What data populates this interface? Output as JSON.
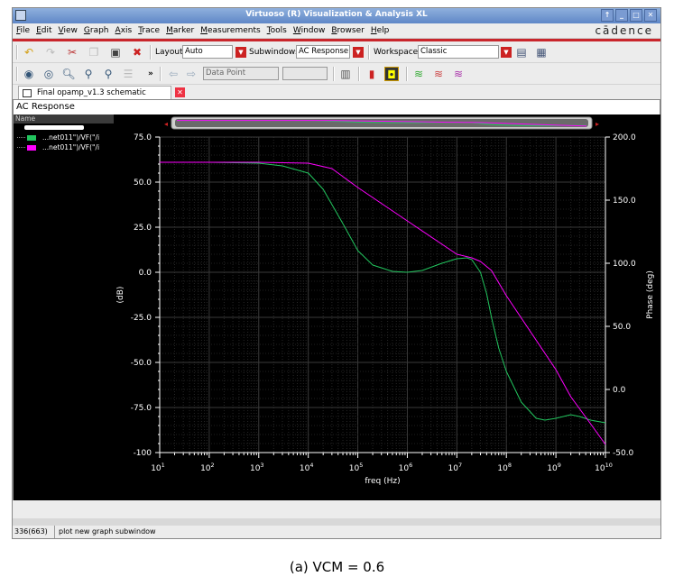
{
  "window": {
    "title": "Virtuoso (R) Visualization & Analysis XL"
  },
  "menubar": {
    "items": [
      "File",
      "Edit",
      "View",
      "Graph",
      "Axis",
      "Trace",
      "Marker",
      "Measurements",
      "Tools",
      "Window",
      "Browser",
      "Help"
    ],
    "brand": "cādence"
  },
  "toolbar1": {
    "layout_label": "Layout:",
    "layout_value": "Auto",
    "subwindows_label": "Subwindows:",
    "subwindows_value": "AC Response",
    "workspace_label": "Workspace:",
    "workspace_value": "Classic"
  },
  "toolbar2": {
    "marker_mode": "Data Point",
    "more": "»"
  },
  "tab": {
    "label": "Final opamp_v1.3 schematic"
  },
  "panel": {
    "title": "AC Response"
  },
  "legend": {
    "header": "Name",
    "traces": [
      {
        "label": "...net011\")/VF(\"/i",
        "color": "#22c55e"
      },
      {
        "label": "...net011\")/VF(\"/i",
        "color": "#ff00ff"
      }
    ]
  },
  "status": {
    "left": "336(663)",
    "message": "plot new graph subwindow"
  },
  "caption": "(a)  VCM = 0.6",
  "chart_data": {
    "type": "line",
    "xlabel": "freq (Hz)",
    "ylabel": "(dB)",
    "y2label": "Phase (deg)",
    "xscale": "log",
    "xlim": [
      10,
      10000000000
    ],
    "ylim": [
      -100,
      75
    ],
    "y2lim": [
      -50,
      200
    ],
    "xticks": [
      "10^1",
      "10^2",
      "10^3",
      "10^4",
      "10^5",
      "10^6",
      "10^7",
      "10^8",
      "10^9",
      "10^10"
    ],
    "yticks": [
      "75.0",
      "50.0",
      "25.0",
      "0.0",
      "-25.0",
      "-50.0",
      "-75.0",
      "-100"
    ],
    "y2ticks": [
      "200.0",
      "150.0",
      "100.0",
      "50.0",
      "0.0",
      "-50.0"
    ],
    "grid": true,
    "series": [
      {
        "color": "#22c55e",
        "axis": "left",
        "points": [
          [
            10,
            61
          ],
          [
            100,
            61
          ],
          [
            1000,
            60.5
          ],
          [
            3000,
            59
          ],
          [
            10000,
            55
          ],
          [
            20000,
            46
          ],
          [
            50000,
            27
          ],
          [
            100000,
            12
          ],
          [
            200000,
            4
          ],
          [
            500000,
            0.5
          ],
          [
            1000000,
            0
          ],
          [
            2000000,
            1
          ],
          [
            5000000,
            5
          ],
          [
            10000000,
            7.5
          ],
          [
            16000000,
            8
          ],
          [
            20000000,
            7
          ],
          [
            30000000,
            0
          ],
          [
            40000000,
            -12
          ],
          [
            50000000,
            -25
          ],
          [
            70000000,
            -42
          ],
          [
            100000000,
            -55
          ],
          [
            200000000,
            -72
          ],
          [
            400000000,
            -81
          ],
          [
            600000000,
            -82
          ],
          [
            1000000000,
            -81
          ],
          [
            2000000000,
            -79
          ],
          [
            3000000000,
            -80
          ],
          [
            5000000000,
            -82
          ],
          [
            10000000000,
            -83.5
          ]
        ]
      },
      {
        "color": "#ff00ff",
        "axis": "left",
        "points": [
          [
            10,
            61
          ],
          [
            100,
            61
          ],
          [
            1000,
            61
          ],
          [
            10000,
            60.5
          ],
          [
            30000,
            57.5
          ],
          [
            100000,
            47
          ],
          [
            1000000,
            28.5
          ],
          [
            10000000,
            10
          ],
          [
            20000000,
            8
          ],
          [
            30000000,
            6
          ],
          [
            50000000,
            1
          ],
          [
            100000000,
            -13
          ],
          [
            1000000000,
            -54
          ],
          [
            2000000000,
            -69
          ],
          [
            5000000000,
            -84
          ],
          [
            10000000000,
            -95.5
          ]
        ]
      }
    ]
  }
}
